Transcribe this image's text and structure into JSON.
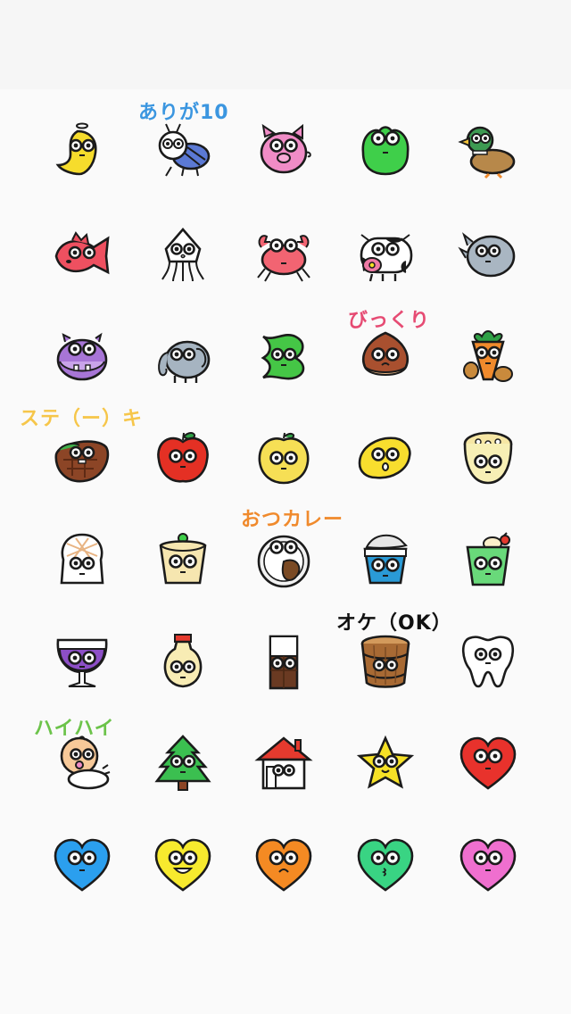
{
  "labels": {
    "arigato": {
      "text": "ありが10",
      "color": "#3b96e0"
    },
    "bikkuri": {
      "text": "びっくり",
      "color": "#e64b73"
    },
    "steak": {
      "text": "ステ（ー）キ",
      "color": "#f6c64a"
    },
    "okarei": {
      "text": "おつカレー",
      "color": "#f08a2c"
    },
    "oke": {
      "text": "オケ（OK）",
      "color": "#111111"
    },
    "haihai": {
      "text": "ハイハイ",
      "color": "#6cc34a"
    }
  },
  "emojis": [
    [
      "banana-icon",
      "ant-icon",
      "pig-icon",
      "frog-icon",
      "duck-icon"
    ],
    [
      "fish-icon",
      "squid-icon",
      "crab-icon",
      "cow-icon",
      "rhino-icon"
    ],
    [
      "hippo-icon",
      "elephant-icon",
      "seaweed-icon",
      "chestnut-icon",
      "carrot-icon"
    ],
    [
      "steak-icon",
      "apple-icon",
      "pear-icon",
      "lemon-icon",
      "lotus-root-icon"
    ],
    [
      "onigiri-icon",
      "pudding-icon",
      "curry-icon",
      "yogurt-icon",
      "cream-soda-icon"
    ],
    [
      "grape-wine-icon",
      "mayonnaise-icon",
      "chocolate-icon",
      "wooden-tub-icon",
      "tooth-icon"
    ],
    [
      "baby-icon",
      "tree-icon",
      "house-icon",
      "star-icon",
      "red-heart-icon"
    ],
    [
      "blue-heart-icon",
      "yellow-heart-icon",
      "orange-heart-icon",
      "green-heart-icon",
      "pink-heart-icon"
    ]
  ],
  "colors": {
    "outline": "#1b1b1b",
    "banana": "#f6dc2c",
    "ant": "#5b79d4",
    "pig": "#f08cc6",
    "frog": "#3fcf4a",
    "duck": "#3d9a52",
    "fish": "#ee5060",
    "squid": "#ffffff",
    "crab": "#f26472",
    "cow": "#ffffff",
    "rhino": "#a9b6c2",
    "hippo": "#a775d6",
    "elephant": "#a6b4c1",
    "seaweed": "#45c646",
    "chestnut": "#a9502f",
    "carrot": "#f08a2c",
    "steak": "#8c4526",
    "apple": "#e43024",
    "pear": "#f6df55",
    "lemon": "#f8de2e",
    "lotus": "#f7efb5",
    "onigiri": "#ffffff",
    "pudding": "#f6e6b0",
    "curry": "#f2f2f2",
    "yogurt": "#2a9ad6",
    "soda": "#69d97a",
    "wine": "#8d4fc7",
    "mayo": "#f8ecb4",
    "choco": "#6a3a22",
    "tub": "#a86a34",
    "tooth": "#ffffff",
    "baby": "#f7c999",
    "tree": "#3bbf50",
    "house": "#e53a2e",
    "star": "#f6e126",
    "heart_red": "#e8322c",
    "heart_blue": "#2b9fee",
    "heart_yellow": "#f7ea2e",
    "heart_orange": "#f48a23",
    "heart_green": "#39d483",
    "heart_pink": "#ef6fcf"
  }
}
